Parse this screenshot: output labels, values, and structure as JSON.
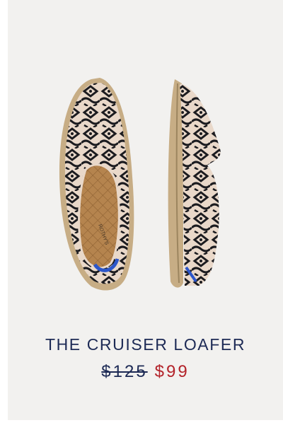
{
  "product": {
    "name": "THE CRUISER LOAFER",
    "original_price": "$125",
    "sale_price": "$99",
    "insole_brand": "ROTHY'S",
    "image_icon": "loafer-product-photo"
  },
  "colors": {
    "card_background": "#f2f1ef",
    "title": "#1d2a55",
    "sale_price": "#b3232a",
    "knit_base": "#e9d8c9",
    "knit_pattern": "#1b1b1f",
    "sole": "#c7ad85",
    "heel_tab": "#2c56c9"
  }
}
